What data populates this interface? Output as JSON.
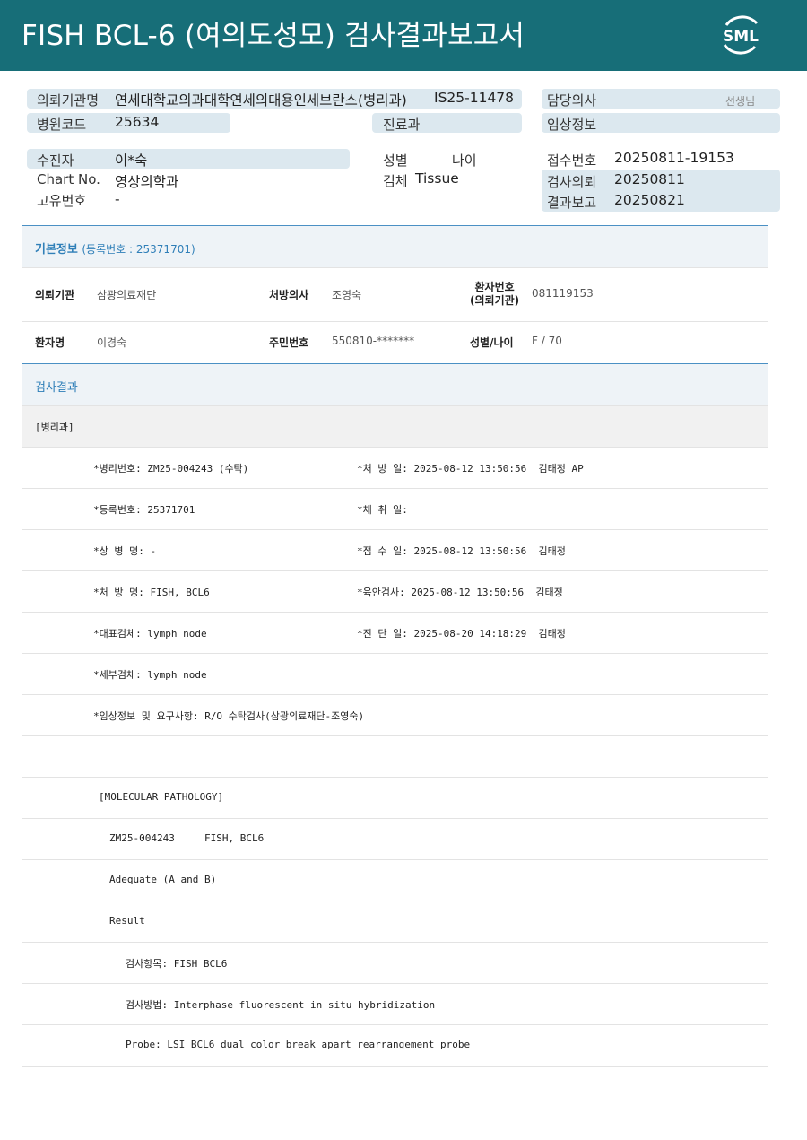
{
  "header": {
    "title": "FISH BCL-6 (여의도성모) 검사결과보고서",
    "logo_text": "SML",
    "bg_color": "#176e78"
  },
  "top_info": {
    "requesting_institution_label": "의뢰기관명",
    "requesting_institution_value": "연세대학교의과대학연세의대용인세브란스(병리과)",
    "sample_id": "IS25-11478",
    "attending_doctor_label": "담당의사",
    "attending_doctor_value": "선생님",
    "hospital_code_label": "병원코드",
    "hospital_code_value": "25634",
    "department_label": "진료과",
    "clinical_info_label": "임상정보",
    "patient_label": "수진자",
    "patient_value": "이*숙",
    "sex_label": "성별",
    "age_label": "나이",
    "receipt_no_label": "접수번호",
    "receipt_no_value": "20250811-19153",
    "chart_no_label": "Chart No.",
    "chart_no_value": "영상의학과",
    "specimen_label": "검체",
    "specimen_value": "Tissue",
    "test_request_label": "검사의뢰",
    "test_request_value": "20250811",
    "unique_no_label": "고유번호",
    "unique_no_value": "-",
    "result_report_label": "결과보고",
    "result_report_value": "20250821"
  },
  "basic_info": {
    "title": "기본정보",
    "reg_no": "(등록번호 : 25371701)",
    "institution_label": "의뢰기관",
    "institution_value": "삼광의료재단",
    "prescriber_label": "처방의사",
    "prescriber_value": "조영숙",
    "patient_no_label_1": "환자번호",
    "patient_no_label_2": "(의뢰기관)",
    "patient_no_value": "081119153",
    "patient_name_label": "환자명",
    "patient_name_value": "이경숙",
    "rrn_label": "주민번호",
    "rrn_value": "550810-*******",
    "sex_age_label": "성별/나이",
    "sex_age_value": "F / 70"
  },
  "results": {
    "title": "검사결과",
    "dept": "[병리과]",
    "rows": [
      {
        "left": "*병리번호: ZM25-004243 (수탁)",
        "right": "*처 방 일: 2025-08-12 13:50:56  김태정 AP"
      },
      {
        "left": "*등록번호: 25371701",
        "right": "*채 취 일:"
      },
      {
        "left": "*상 병 명: -",
        "right": "*접 수 일: 2025-08-12 13:50:56  김태정"
      },
      {
        "left": "*처 방 명: FISH, BCL6",
        "right": "*육안검사: 2025-08-12 13:50:56  김태정"
      },
      {
        "left": "*대표검체: lymph node",
        "right": "*진 단 일: 2025-08-20 14:18:29  김태정"
      },
      {
        "left": "*세부검체: lymph node",
        "right": ""
      },
      {
        "left": "*임상정보 및 요구사항: R/O 수탁검사(삼광의료재단-조영숙)",
        "right": ""
      }
    ],
    "molecular": [
      "[MOLECULAR PATHOLOGY]",
      "ZM25-004243     FISH, BCL6",
      "Adequate (A and B)",
      "Result",
      "검사항목: FISH BCL6",
      "검사방법: Interphase fluorescent in situ hybridization",
      "Probe: LSI BCL6 dual color break apart rearrangement probe"
    ]
  }
}
